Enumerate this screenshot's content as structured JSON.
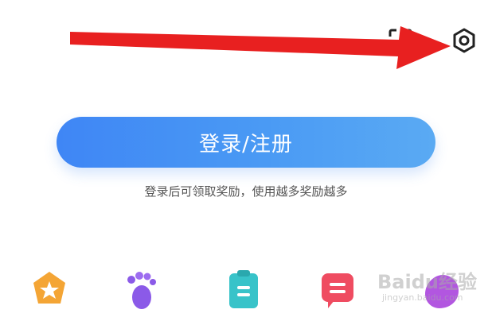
{
  "header": {
    "scan_icon": "scan-icon",
    "settings_icon": "settings-icon"
  },
  "login": {
    "button_label": "登录/注册",
    "hint": "登录后可领取奖励，使用越多奖励越多"
  },
  "bottom_icons": [
    "star-icon",
    "footprint-icon",
    "clipboard-icon",
    "message-icon",
    "purple-icon"
  ],
  "watermark": {
    "logo": "Baidu经验",
    "url": "jingyan.baidu.com"
  },
  "colors": {
    "button_gradient_start": "#3f86f5",
    "button_gradient_end": "#5aaaf3",
    "arrow": "#e82020"
  }
}
